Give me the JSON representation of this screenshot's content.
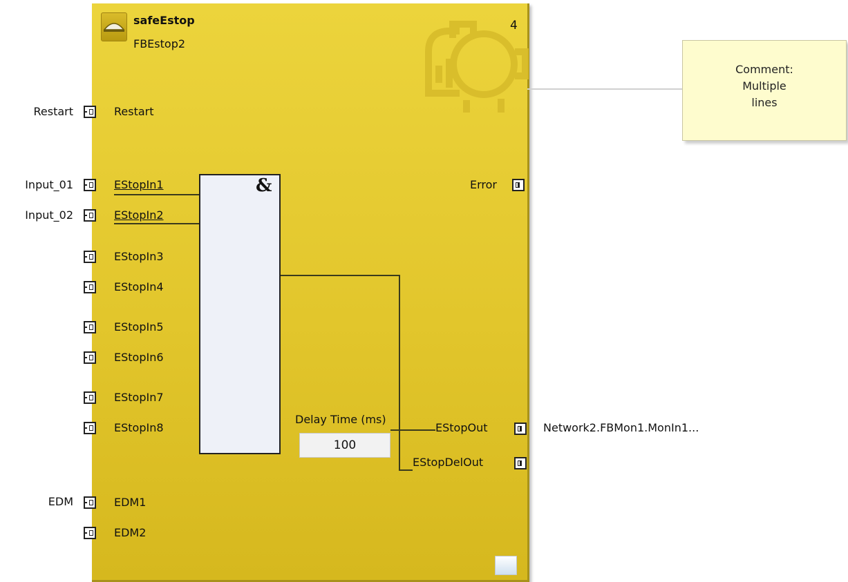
{
  "block": {
    "type_name": "safeEstop",
    "instance_name": "FBEstop2",
    "number": "4",
    "icon": "estop-mushroom-icon",
    "color": "#e2c62c"
  },
  "inputs": [
    {
      "var": "Restart",
      "port": "Restart"
    },
    {
      "var": "Input_01",
      "port": "EStopIn1"
    },
    {
      "var": "Input_02",
      "port": "EStopIn2"
    },
    {
      "var": "",
      "port": "EStopIn3"
    },
    {
      "var": "",
      "port": "EStopIn4"
    },
    {
      "var": "",
      "port": "EStopIn5"
    },
    {
      "var": "",
      "port": "EStopIn6"
    },
    {
      "var": "",
      "port": "EStopIn7"
    },
    {
      "var": "",
      "port": "EStopIn8"
    },
    {
      "var": "EDM",
      "port": "EDM1"
    },
    {
      "var": "",
      "port": "EDM2"
    }
  ],
  "and_gate": {
    "symbol": "&"
  },
  "delay": {
    "label": "Delay Time (ms)",
    "value": "100"
  },
  "outputs": [
    {
      "port": "Error",
      "target": ""
    },
    {
      "port": "EStopOut",
      "target": "Network2.FBMon1.MonIn1..."
    },
    {
      "port": "EStopDelOut",
      "target": ""
    }
  ],
  "comment": {
    "lines": [
      "Comment:",
      "Multiple",
      "lines"
    ]
  }
}
